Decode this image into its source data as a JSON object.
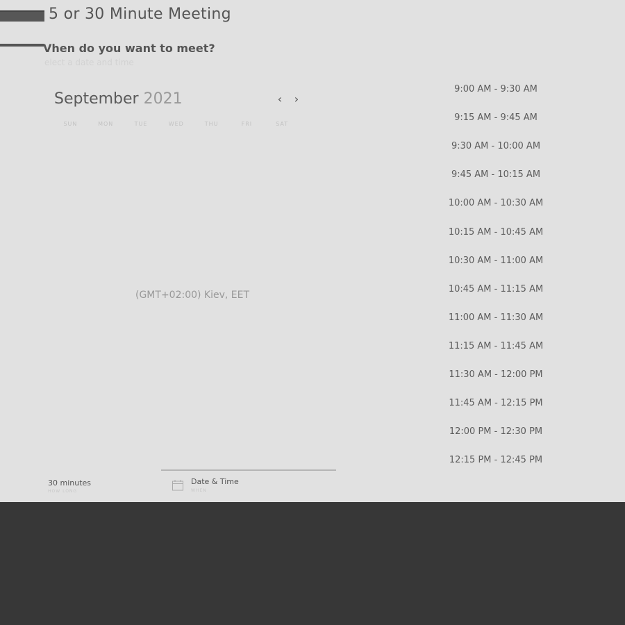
{
  "header": {
    "title": "5 or 30 Minute Meeting",
    "question": "Vhen do you want to meet?",
    "subtitle": "elect a date and time"
  },
  "calendar": {
    "month": "September",
    "year": "2021",
    "prev_icon": "chevron-left-icon",
    "next_icon": "chevron-right-icon",
    "weekdays": [
      "SUN",
      "MON",
      "TUE",
      "WED",
      "THU",
      "FRI",
      "SAT"
    ]
  },
  "timezone": "(GMT+02:00) Kiev, EET",
  "slots": [
    "9:00 AM - 9:30 AM",
    "9:15 AM - 9:45 AM",
    "9:30 AM - 10:00 AM",
    "9:45 AM - 10:15 AM",
    "10:00 AM - 10:30 AM",
    "10:15 AM - 10:45 AM",
    "10:30 AM - 11:00 AM",
    "10:45 AM - 11:15 AM",
    "11:00 AM - 11:30 AM",
    "11:15 AM - 11:45 AM",
    "11:30 AM - 12:00 PM",
    "11:45 AM - 12:15 PM",
    "12:00 PM - 12:30 PM",
    "12:15 PM - 12:45 PM"
  ],
  "footer": {
    "duration": "30 minutes",
    "duration_label": "HOW LONG",
    "when": "Date & Time",
    "when_label": "WHEN",
    "when_icon": "calendar-icon"
  },
  "colors": {
    "panel_bg": "#e1e1e1",
    "page_bg": "#373737",
    "text": "#555555"
  }
}
